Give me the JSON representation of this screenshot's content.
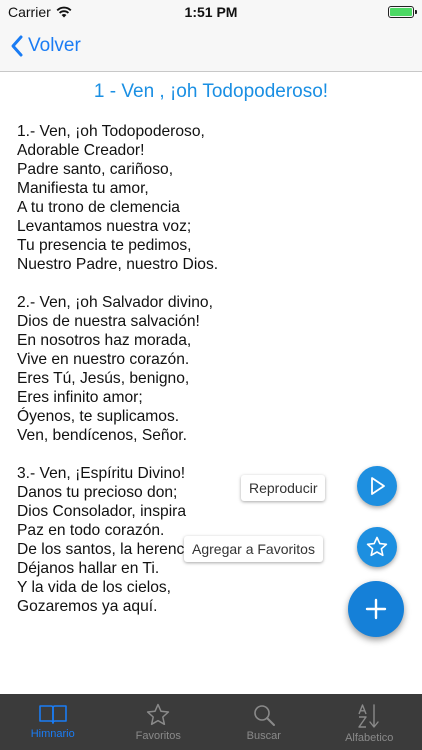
{
  "status_bar": {
    "carrier": "Carrier",
    "time": "1:51 PM"
  },
  "nav": {
    "back_label": "Volver"
  },
  "hymn": {
    "title": "1 - Ven , ¡oh Todopoderoso!",
    "stanzas": [
      [
        "1.- Ven, ¡oh Todopoderoso,",
        "Adorable Creador!",
        "Padre santo, cariñoso,",
        "Manifiesta tu amor,",
        "A tu trono de clemencia",
        "Levantamos nuestra voz;",
        "Tu presencia te pedimos,",
        "Nuestro Padre, nuestro Dios."
      ],
      [
        "2.- Ven, ¡oh Salvador divino,",
        "Dios de nuestra salvación!",
        "En nosotros haz morada,",
        "Vive en nuestro corazón.",
        "Eres Tú, Jesús, benigno,",
        "Eres infinito amor;",
        "Óyenos, te suplicamos.",
        "Ven, bendícenos, Señor."
      ],
      [
        "3.- Ven, ¡Espíritu Divino!",
        "Danos tu precioso don;",
        "Dios Consolador, inspira",
        "Paz en todo corazón.",
        "De los santos, la herencia",
        "Déjanos hallar en Ti.",
        "Y la vida de los cielos,",
        "Gozaremos ya aquí."
      ]
    ]
  },
  "fab": {
    "play_label": "Reproducir",
    "favorite_label": "Agregar a Favoritos",
    "play_icon": "play-icon",
    "favorite_icon": "star-icon",
    "main_icon": "plus-icon"
  },
  "tabs": [
    {
      "label": "Himnario",
      "icon": "book-icon",
      "active": true
    },
    {
      "label": "Favoritos",
      "icon": "star-icon",
      "active": false
    },
    {
      "label": "Buscar",
      "icon": "search-icon",
      "active": false
    },
    {
      "label": "Alfabetico",
      "icon": "sort-alpha-icon",
      "active": false
    }
  ],
  "colors": {
    "accent": "#1a7cf4",
    "title": "#1a8fe3",
    "fab": "#1d8fe0",
    "tab_bar_bg": "#3b3b3b",
    "battery": "#4cd964"
  },
  "battery_level": 1.0
}
